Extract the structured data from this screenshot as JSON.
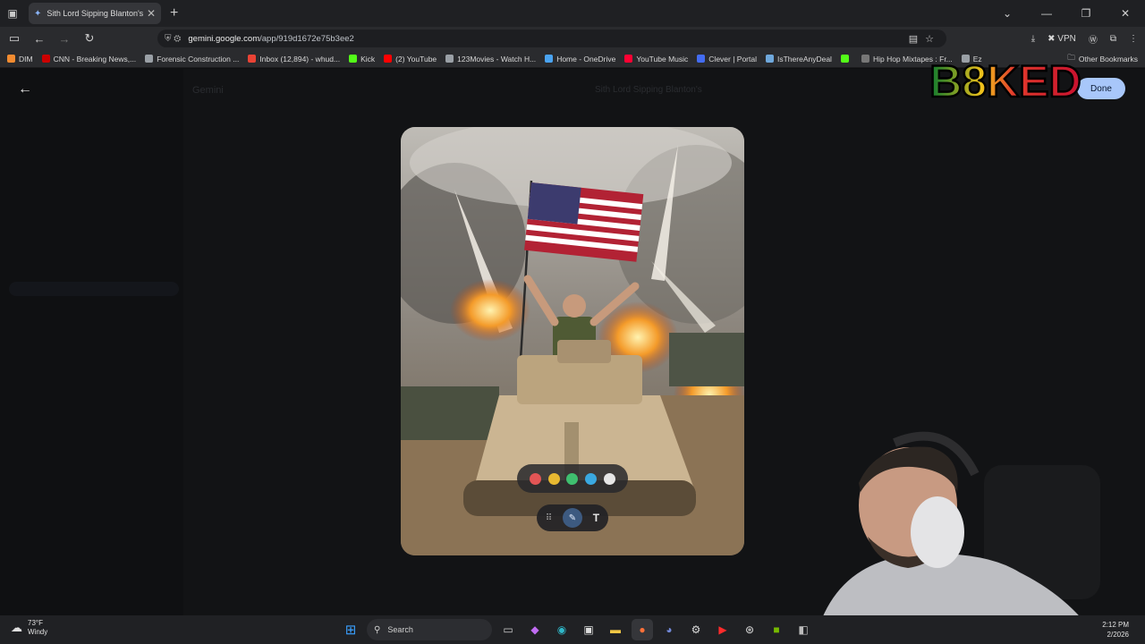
{
  "browser": {
    "tab_title": "Sith Lord Sipping Blanton's - G",
    "url_host": "gemini.google.com",
    "url_path": "/app/919d1672e75b3ee2",
    "vpn_label": "VPN",
    "bookmarks": [
      {
        "label": "DIM",
        "color": "#f28b30"
      },
      {
        "label": "CNN - Breaking News,...",
        "color": "#cc0000"
      },
      {
        "label": "Forensic Construction ...",
        "color": "#9aa0a6"
      },
      {
        "label": "Inbox (12,894) - whud...",
        "color": "#ea4335"
      },
      {
        "label": "Kick",
        "color": "#53fc18"
      },
      {
        "label": "(2) YouTube",
        "color": "#ff0000"
      },
      {
        "label": "123Movies - Watch H...",
        "color": "#9aa0a6"
      },
      {
        "label": "Home - OneDrive",
        "color": "#4aa3f0"
      },
      {
        "label": "YouTube Music",
        "color": "#ff0033"
      },
      {
        "label": "Clever | Portal",
        "color": "#436cf2"
      },
      {
        "label": "IsThereAnyDeal",
        "color": "#6fa8dc"
      },
      {
        "label": "",
        "color": "#53fc18"
      },
      {
        "label": "Hip Hop Mixtapes : Fr...",
        "color": "#777777"
      },
      {
        "label": "Ez",
        "color": "#9aa0a6"
      }
    ],
    "other_bookmarks": "Other Bookmarks"
  },
  "gemini": {
    "done_label": "Done",
    "title_dim": "Sith Lord Sipping Blanton's",
    "app_name_dim": "Gemini",
    "colors": {
      "swatches": [
        "#e25555",
        "#e8b931",
        "#3fbf6f",
        "#3aa8e0",
        "#e6e6e6"
      ]
    }
  },
  "overlay": {
    "logo_text": "B8KED"
  },
  "taskbar": {
    "temp": "73°F",
    "condition": "Windy",
    "search_placeholder": "Search",
    "time": "2:12 PM",
    "date": "2/2026"
  }
}
